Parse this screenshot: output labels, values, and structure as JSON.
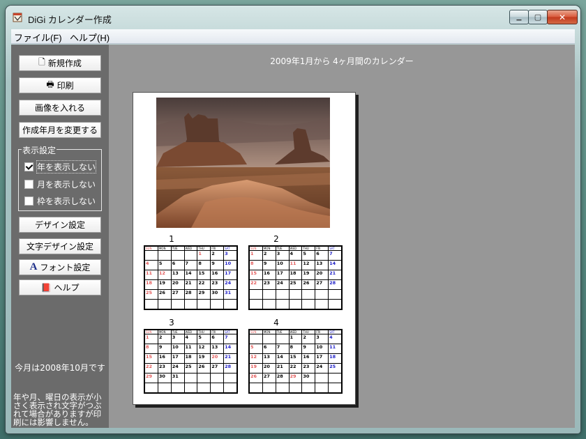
{
  "window": {
    "title": "DiGi カレンダー作成",
    "minimize_glyph": "▁",
    "maximize_glyph": "▢",
    "close_glyph": "✕"
  },
  "menu": [
    "ファイル(F)",
    "ヘルプ(H)"
  ],
  "sidebar": {
    "buttons": [
      {
        "label": "新規作成",
        "icon": "new-document-icon",
        "glyph": "🗋"
      },
      {
        "label": "印刷",
        "icon": "printer-icon",
        "glyph": "🖶"
      },
      {
        "label": "画像を入れる"
      },
      {
        "label": "作成年月を変更する"
      }
    ],
    "display_settings": {
      "title": "表示設定",
      "options": [
        {
          "label": "年を表示しない",
          "checked": true
        },
        {
          "label": "月を表示しない",
          "checked": false
        },
        {
          "label": "枠を表示しない",
          "checked": false
        }
      ]
    },
    "buttons2": [
      {
        "label": "デザイン設定"
      },
      {
        "label": "文字デザイン設定"
      },
      {
        "label": "フォント設定",
        "icon": "font-icon",
        "glyph": "A"
      },
      {
        "label": "ヘルプ",
        "icon": "help-book-icon",
        "glyph": "📕"
      }
    ],
    "today_text": "今月は2008年10月です",
    "notice_text": "年や月、曜日の表示が小さく表示され文字がつぶれて場合がありますが印刷には影響しません。"
  },
  "main": {
    "heading": "2009年1月から 4ヶ月間のカレンダー"
  },
  "calendar": {
    "weekday_headers": [
      "SUN",
      "MON",
      "TUE",
      "WED",
      "THU",
      "FRI",
      "SAT"
    ],
    "months": [
      {
        "label": "1",
        "first_weekday": 4,
        "days": 31
      },
      {
        "label": "2",
        "first_weekday": 0,
        "days": 28
      },
      {
        "label": "3",
        "first_weekday": 0,
        "days": 31
      },
      {
        "label": "4",
        "first_weekday": 3,
        "days": 30
      }
    ],
    "holidays": {
      "1": [
        1,
        12
      ],
      "2": [
        11
      ],
      "3": [
        20
      ],
      "4": [
        29
      ]
    },
    "colors": {
      "sunday": "#e35b5b",
      "saturday": "#2222c8",
      "holiday": "#e35b5b",
      "weekday": "#000000"
    }
  }
}
